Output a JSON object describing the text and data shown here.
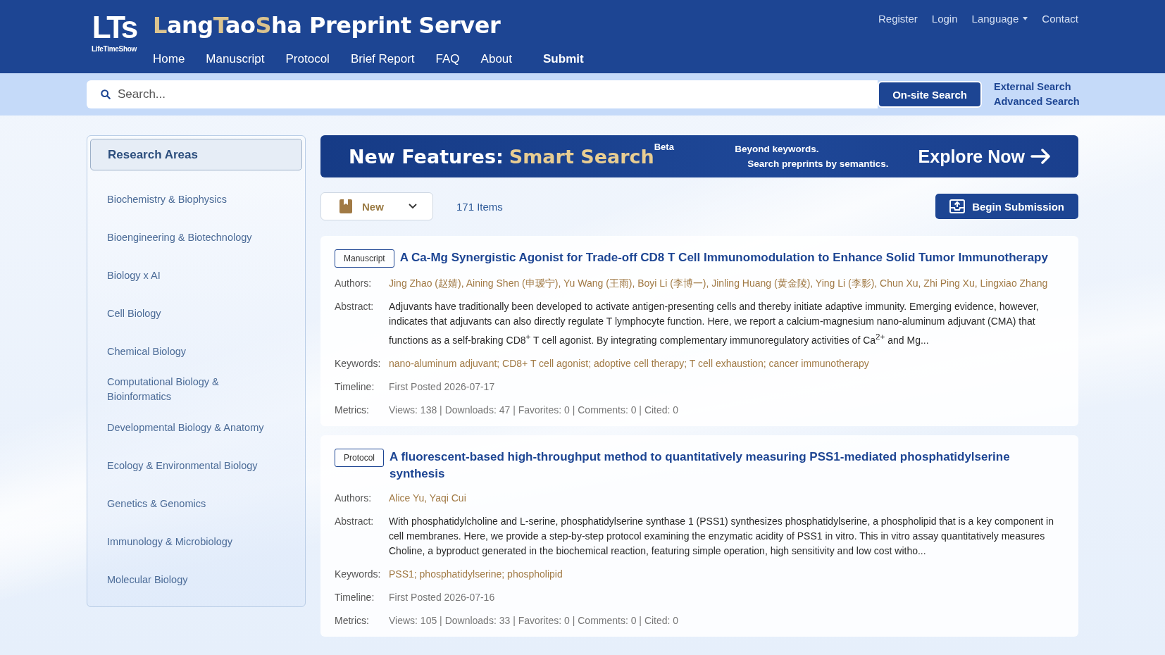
{
  "header": {
    "logo": {
      "mark": "LTs",
      "caption": "LifeTimeShow"
    },
    "title": [
      {
        "text": "L",
        "accent": true
      },
      {
        "text": "ang",
        "accent": false
      },
      {
        "text": "T",
        "accent": true
      },
      {
        "text": "ao",
        "accent": false
      },
      {
        "text": "S",
        "accent": true
      },
      {
        "text": "ha Preprint Server",
        "accent": false
      }
    ],
    "nav": [
      {
        "label": "Home",
        "emphasized": false
      },
      {
        "label": "Manuscript",
        "emphasized": false
      },
      {
        "label": "Protocol",
        "emphasized": false
      },
      {
        "label": "Brief Report",
        "emphasized": false
      },
      {
        "label": "FAQ",
        "emphasized": false
      },
      {
        "label": "About",
        "emphasized": false
      },
      {
        "label": "Submit",
        "emphasized": true
      }
    ],
    "account_links": [
      {
        "label": "Register",
        "dropdown": false
      },
      {
        "label": "Login",
        "dropdown": false
      },
      {
        "label": "Language",
        "dropdown": true
      },
      {
        "label": "Contact",
        "dropdown": false
      }
    ]
  },
  "search": {
    "placeholder": "Search...",
    "button": "On-site Search",
    "links": [
      "External Search",
      "Advanced Search"
    ]
  },
  "sidebar": {
    "title": "Research Areas",
    "items": [
      "Biochemistry & Biophysics",
      "Bioengineering & Biotechnology",
      "Biology x AI",
      "Cell Biology",
      "Chemical Biology",
      "Computational Biology & Bioinformatics",
      "Developmental Biology & Anatomy",
      "Ecology & Environmental Biology",
      "Genetics & Genomics",
      "Immunology & Microbiology",
      "Molecular Biology"
    ]
  },
  "banner": {
    "headline": "New Features:",
    "highlight": "Smart Search",
    "badge": "Beta",
    "tagline": [
      "Beyond keywords.",
      "Search preprints by semantics."
    ],
    "cta": "Explore Now"
  },
  "toolbar": {
    "sort": "New",
    "count": "171 Items",
    "submit_button": "Begin Submission"
  },
  "articles": [
    {
      "type": "Manuscript",
      "title": "A Ca-Mg Synergistic Agonist for Trade-off CD8 T Cell Immunomodulation to Enhance Solid Tumor Immunotherapy",
      "fields": [
        {
          "label": "Authors:",
          "kind": "accent",
          "value": "Jing Zhao (赵婧), Aining Shen (申瑷宁), Yu Wang (王雨), Boyi Li (李博一), Jinling Huang (黄金陵), Ying Li (李影), Chun Xu, Zhi Ping Xu, Lingxiao Zhang"
        },
        {
          "label": "Abstract:",
          "kind": "body",
          "value": "Adjuvants have traditionally been developed to activate antigen-presenting cells and thereby initiate adaptive immunity. Emerging evidence, however, indicates that adjuvants can also directly regulate T lymphocyte function. Here, we report a calcium-magnesium nano-aluminum adjuvant (CMA) that functions as a self-braking CD8$^{+}$ T cell agonist. By integrating complementary immunoregulatory activities of Ca$^{2+}$ and Mg..."
        },
        {
          "label": "Keywords:",
          "kind": "accent",
          "value": "nano-aluminum adjuvant; CD8+ T cell agonist; adoptive cell therapy; T cell exhaustion; cancer immunotherapy"
        },
        {
          "label": "Timeline:",
          "kind": "muted",
          "value": "First Posted 2026-07-17"
        },
        {
          "label": "Metrics:",
          "kind": "muted",
          "value": "Views: 138 | Downloads: 47 | Favorites: 0 | Comments: 0 | Cited: 0"
        }
      ]
    },
    {
      "type": "Protocol",
      "title": "A fluorescent-based high-throughput method to quantitatively measuring PSS1-mediated phosphatidylserine synthesis",
      "fields": [
        {
          "label": "Authors:",
          "kind": "accent",
          "value": "Alice Yu, Yaqi Cui"
        },
        {
          "label": "Abstract:",
          "kind": "body",
          "value": "With phosphatidylcholine and L-serine, phosphatidylserine synthase 1 (PSS1) synthesizes phosphatidylserine, a phospholipid that is a key component in cell membranes. Here, we provide a step-by-step protocol examining the enzymatic acidity of PSS1 in vitro. This in vitro assay quantitatively measures Choline, a byproduct generated in the biochemical reaction, featuring simple operation, high sensitivity and low cost witho..."
        },
        {
          "label": "Keywords:",
          "kind": "accent",
          "value": "PSS1; phosphatidylserine; phospholipid"
        },
        {
          "label": "Timeline:",
          "kind": "muted",
          "value": "First Posted 2026-07-16"
        },
        {
          "label": "Metrics:",
          "kind": "muted",
          "value": "Views: 105 | Downloads: 33 | Favorites: 0 | Comments: 0 | Cited: 0"
        }
      ]
    }
  ]
}
